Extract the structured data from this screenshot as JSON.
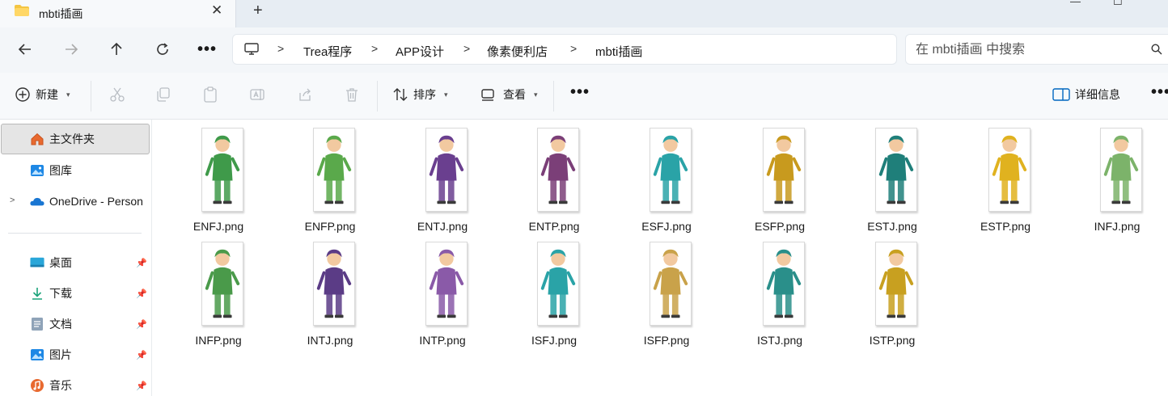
{
  "window": {
    "tab_title": "mbti插画",
    "tab_close_icon": "close-icon",
    "new_tab_icon": "plus-icon"
  },
  "nav": {
    "breadcrumbs": [
      "Trea程序",
      "APP设计",
      "像素便利店",
      "mbti插画"
    ],
    "search_placeholder": "在 mbti插画 中搜索"
  },
  "toolbar": {
    "new_label": "新建",
    "sort_label": "排序",
    "view_label": "查看",
    "details_label": "详细信息"
  },
  "sidebar": {
    "items": [
      {
        "label": "主文件夹",
        "icon": "home-icon",
        "pinned": false
      },
      {
        "label": "图库",
        "icon": "gallery-icon",
        "pinned": false
      },
      {
        "label": "OneDrive - Person",
        "icon": "onedrive-icon",
        "pinned": false
      },
      {
        "label": "桌面",
        "icon": "desktop-icon",
        "pinned": true
      },
      {
        "label": "下载",
        "icon": "download-icon",
        "pinned": true
      },
      {
        "label": "文档",
        "icon": "documents-icon",
        "pinned": true
      },
      {
        "label": "图片",
        "icon": "pictures-icon",
        "pinned": true
      },
      {
        "label": "音乐",
        "icon": "music-icon",
        "pinned": true
      }
    ]
  },
  "files": [
    {
      "name": "ENFJ.png",
      "color": "#3f9a4a"
    },
    {
      "name": "ENFP.png",
      "color": "#5aa94b"
    },
    {
      "name": "ENTJ.png",
      "color": "#6a3f8f"
    },
    {
      "name": "ENTP.png",
      "color": "#7b3f78"
    },
    {
      "name": "ESFJ.png",
      "color": "#2aa3a7"
    },
    {
      "name": "ESFP.png",
      "color": "#c89a1e"
    },
    {
      "name": "ESTJ.png",
      "color": "#1f7f7a"
    },
    {
      "name": "ESTP.png",
      "color": "#e0b21f"
    },
    {
      "name": "INFJ.png",
      "color": "#7cb36a"
    },
    {
      "name": "INFP.png",
      "color": "#4a9a4a"
    },
    {
      "name": "INTJ.png",
      "color": "#5b3c86"
    },
    {
      "name": "INTP.png",
      "color": "#8a5aa8"
    },
    {
      "name": "ISFJ.png",
      "color": "#2aa3a7"
    },
    {
      "name": "ISFP.png",
      "color": "#c9a24a"
    },
    {
      "name": "ISTJ.png",
      "color": "#2a8f8a"
    },
    {
      "name": "ISTP.png",
      "color": "#c8a020"
    }
  ]
}
